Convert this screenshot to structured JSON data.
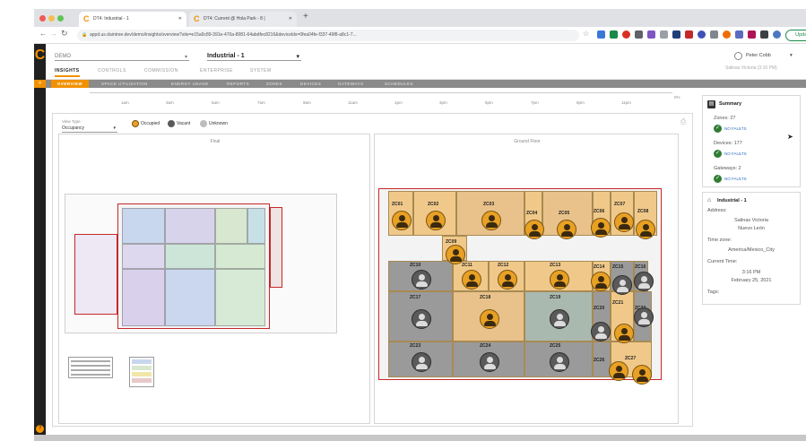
{
  "browser": {
    "tabs": [
      "DT4: Industrial - 1",
      "DT4: Current @ Hola Park - 8 |"
    ],
    "new_tab": "+",
    "url": "appd.us.daintree.dev/demo/insights/overview?site=e15a9c89-391e-470a-8081-64abdfec8216&devicelds=0fea04fe-f337-49f8-a8c1-7...",
    "update_label": "Update"
  },
  "app": {
    "company_select": "DEMO",
    "site_select": "Industrial - 1",
    "nav": [
      "INSIGHTS",
      "CONTROLS",
      "COMMISSION",
      "ENTERPRISE",
      "SYSTEM"
    ],
    "subnav": [
      "OVERVIEW",
      "SPACE UTILIZATION",
      "ENERGY USAGE",
      "REPORTS",
      "ZONES",
      "DEVICES",
      "GATEWAYS",
      "SCHEDULES"
    ],
    "user_name": "Peter Cobb",
    "user_location": "Salinas Victoria (3:16 PM)"
  },
  "timeline": {
    "ticks": [
      "1am",
      "3am",
      "5am",
      "7am",
      "9am",
      "11am",
      "1pm",
      "3pm",
      "5pm",
      "7pm",
      "9pm",
      "11pm"
    ],
    "right_label": "0%"
  },
  "main": {
    "view_type_label": "View Type",
    "view_type_value": "Occupancy",
    "legend": {
      "occupied": "Occupied",
      "vacant": "Vacant",
      "unknown": "Unknown"
    },
    "floor_left_title": "Final",
    "floor_right_title": "Ground Floor"
  },
  "zones": [
    "ZC01",
    "ZC02",
    "ZC03",
    "ZC04",
    "ZC05",
    "ZC06",
    "ZC07",
    "ZC08",
    "ZC09",
    "ZC10",
    "ZC11",
    "ZC12",
    "ZC13",
    "ZC14",
    "ZC15",
    "ZC16",
    "ZC17",
    "ZC18",
    "ZC19",
    "ZC20",
    "ZC21",
    "ZC22",
    "ZC23",
    "ZC24",
    "ZC25",
    "ZC26",
    "ZC27"
  ],
  "summary": {
    "title": "Summary",
    "zones": "Zones: 27",
    "devices": "Devices: 177",
    "gateways": "Gateways: 2",
    "no_faults": "NO FAULTS"
  },
  "site_info": {
    "title": "Industrial - 1",
    "address_label": "Address:",
    "address_line1": "Salinas Victoria",
    "address_line2": "Nuevo León",
    "timezone_label": "Time zone:",
    "timezone": "America/Mexico_City",
    "current_time_label": "Current Time:",
    "time": "3:16 PM",
    "date": "February 25, 2021",
    "tags_label": "Tags:"
  },
  "colors": {
    "brand": "#f29100",
    "occupied": "#e8a124",
    "vacant": "#5a5a5a",
    "ok": "#2e7d32"
  }
}
